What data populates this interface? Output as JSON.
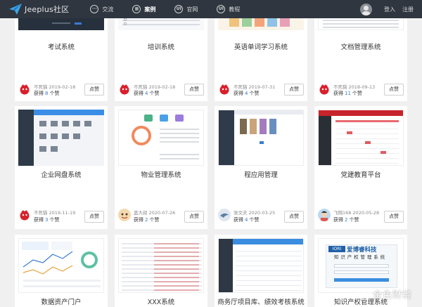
{
  "brand": {
    "name": "Jeeplus社区"
  },
  "nav": [
    {
      "label": "交流",
      "icon": "chat-icon",
      "glyph": "···"
    },
    {
      "label": "案例",
      "icon": "case-icon",
      "glyph": "▦",
      "active": true
    },
    {
      "label": "官网",
      "icon": "ui-icon",
      "glyph": "UI"
    },
    {
      "label": "教程",
      "icon": "ui-icon",
      "glyph": "UI"
    }
  ],
  "user_nav": {
    "login": "登入",
    "register": "注册"
  },
  "like_label": "点赞",
  "likes_prefix": "获得",
  "likes_suffix": "个赞",
  "cards": [
    {
      "title": "考试系统",
      "author": "不死猫",
      "date": "2019-02-18",
      "likes": "8",
      "avatar": "red"
    },
    {
      "title": "培训系统",
      "author": "不死猫",
      "date": "2019-02-18",
      "likes": "4",
      "avatar": "red"
    },
    {
      "title": "英语单词学习系统",
      "author": "不死猫",
      "date": "2019-07-31",
      "likes": "4",
      "avatar": "red"
    },
    {
      "title": "文档管理系统",
      "author": "不死猫",
      "date": "2018-09-13",
      "likes": "11",
      "avatar": "red"
    },
    {
      "title": "企业网盘系统",
      "author": "不死猫",
      "date": "2019-11-19",
      "likes": "3",
      "avatar": "red"
    },
    {
      "title": "物业管理系统",
      "author": "盖大叔",
      "date": "2020-07-26",
      "likes": "2",
      "avatar": "cartoon"
    },
    {
      "title": "程应用管理",
      "author": "张文夫",
      "date": "2020-03-25",
      "likes": "4",
      "avatar": "bird"
    },
    {
      "title": "党建教育平台",
      "author": "飞翔168",
      "date": "2020-05-28",
      "likes": "2",
      "avatar": "kid"
    },
    {
      "title": "数据资产门户",
      "author": "",
      "date": "",
      "likes": "",
      "avatar": ""
    },
    {
      "title": "XXX系统",
      "author": "",
      "date": "",
      "likes": "",
      "avatar": ""
    },
    {
      "title": "商务厅项目库、绩效考核系统",
      "author": "",
      "date": "",
      "likes": "",
      "avatar": ""
    },
    {
      "title": "知识产权管理系统",
      "author": "",
      "date": "",
      "likes": "",
      "avatar": ""
    }
  ],
  "thumb_texts": {
    "ip_logo": "爱博睿科技",
    "ip_sub": "知 识 产 权 管 理 系 统"
  },
  "watermark": {
    "text": "金色财经"
  },
  "colors": {
    "nav_bg": "#2f3640",
    "accent_blue": "#3a7bd5",
    "party_red": "#c8242b"
  }
}
